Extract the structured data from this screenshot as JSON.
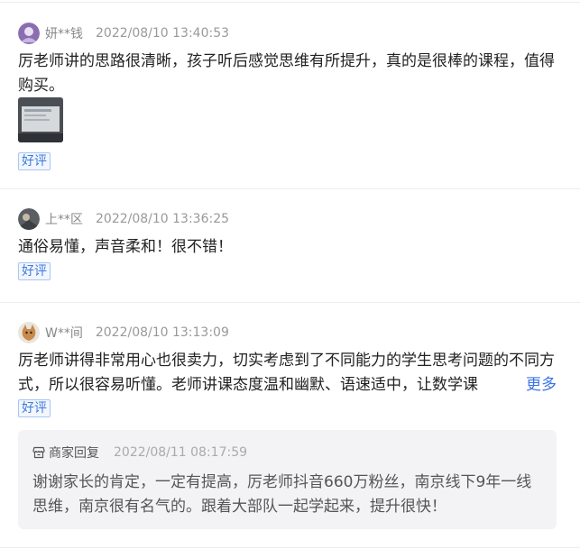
{
  "reviews": [
    {
      "user": "妍**钱",
      "time": "2022/08/10 13:40:53",
      "text": "厉老师讲的思路很清晰，孩子听后感觉思维有所提升，真的是很棒的课程，值得购买。",
      "tag": "好评",
      "has_image": true
    },
    {
      "user": "上**区",
      "time": "2022/08/10 13:36:25",
      "text": "通俗易懂，声音柔和！很不错！",
      "tag": "好评"
    },
    {
      "user": "W**间",
      "time": "2022/08/10 13:13:09",
      "text": "厉老师讲得非常用心也很卖力，切实考虑到了不同能力的学生思考问题的不同方式，所以很容易听懂。老师讲课态度温和幽默、语速适中，让数学课",
      "more": "更多",
      "tag": "好评",
      "reply": {
        "label": "商家回复",
        "time": "2022/08/11 08:17:59",
        "text": "谢谢家长的肯定，一定有提高，厉老师抖音660万粉丝，南京线下9年一线思维，南京很有名气的。跟着大部队一起学起来，提升很快！"
      }
    }
  ],
  "colors": {
    "tag_text": "#3f7ad8",
    "tag_border": "#a9c6f2",
    "more_link": "#3b74e8",
    "reply_bg": "#f3f3f5"
  },
  "icons": {
    "reply": "shop-icon"
  }
}
